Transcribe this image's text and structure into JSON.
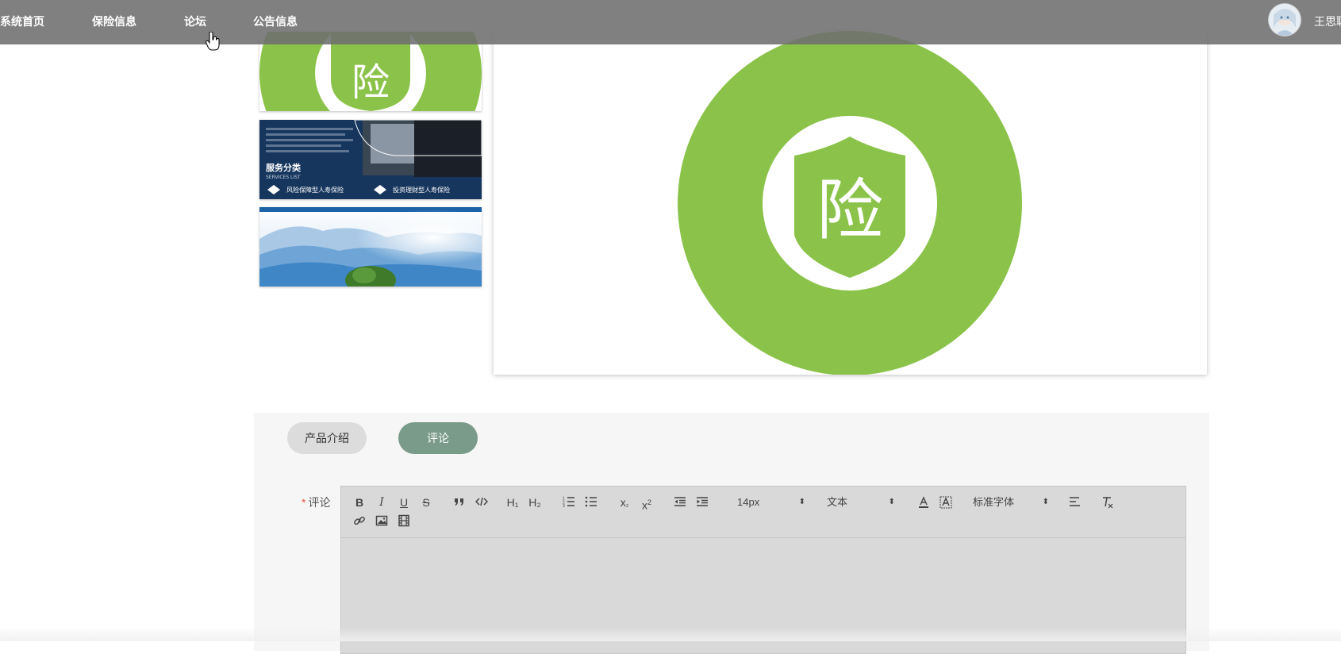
{
  "nav": {
    "items": [
      {
        "label": "系统首页"
      },
      {
        "label": "保险信息"
      },
      {
        "label": "论坛"
      },
      {
        "label": "公告信息"
      }
    ],
    "username": "王思聪"
  },
  "product": {
    "logo_char": "险",
    "thumbnail2": {
      "title": "服务分类",
      "subtitle": "SERVICES LIST",
      "item1": "风险保障型人寿保险",
      "item2": "投资理财型人寿保险"
    }
  },
  "tabs": {
    "intro": "产品介绍",
    "comment": "评论"
  },
  "form": {
    "required_mark": "*",
    "comment_label": "评论"
  },
  "toolbar": {
    "h1": "H₁",
    "h2": "H₂",
    "font_size": "14px",
    "text_style": "文本",
    "font_family": "标准字体"
  },
  "colors": {
    "accent_green": "#8bc34a",
    "active_tab": "#7a9a8a"
  }
}
